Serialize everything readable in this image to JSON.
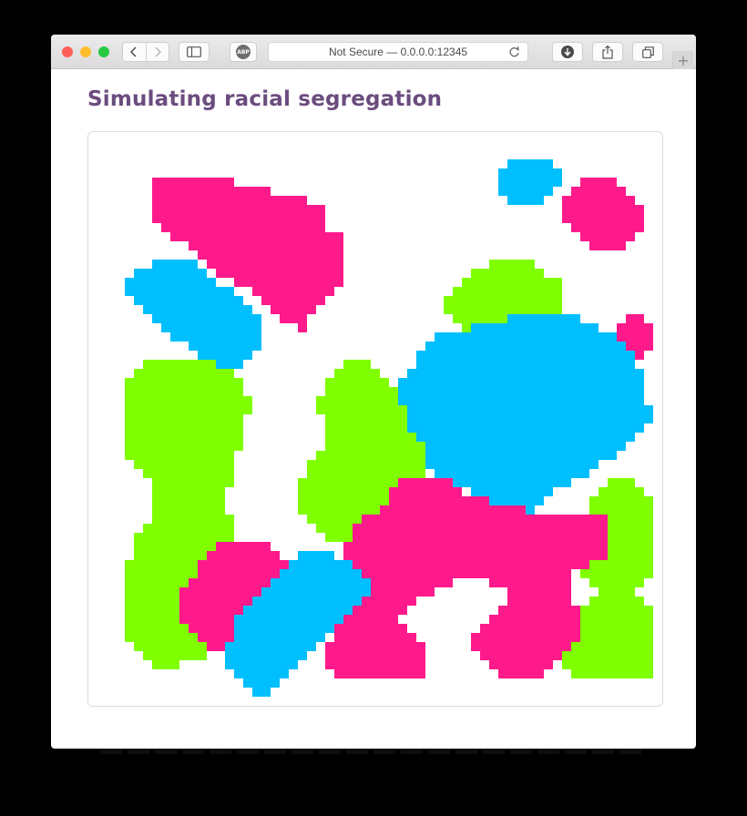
{
  "browser": {
    "address_text": "Not Secure — 0.0.0.0:12345",
    "adblock_label": "ABP",
    "icons": {
      "close": "close-light",
      "minimize": "minimize-light",
      "maximize": "maximize-light",
      "back": "chevron-left-icon",
      "forward": "chevron-right-icon",
      "sidebar": "sidebar-icon",
      "reload": "reload-icon",
      "download": "download-icon",
      "share": "share-icon",
      "tabs": "tabs-overview-icon",
      "new_tab": "plus-icon"
    },
    "colors": {
      "close": "#ff5f57",
      "minimize": "#ffbd2e",
      "maximize": "#28c940"
    }
  },
  "page": {
    "title": "Simulating racial segregation"
  },
  "simulation": {
    "grid_size": 60,
    "colors": {
      "pink": "#ff1a8c",
      "blue": "#00bfff",
      "green": "#80ff00",
      "empty": "#ffffff"
    },
    "regions": [
      {
        "color": "pink",
        "rows": [
          [
            3,
            5,
            14
          ],
          [
            4,
            5,
            18
          ],
          [
            5,
            5,
            22
          ],
          [
            6,
            5,
            24
          ],
          [
            7,
            5,
            24
          ],
          [
            8,
            6,
            24
          ],
          [
            9,
            7,
            26
          ],
          [
            10,
            9,
            26
          ],
          [
            11,
            10,
            26
          ],
          [
            12,
            11,
            26
          ],
          [
            13,
            12,
            26
          ],
          [
            14,
            14,
            26
          ],
          [
            15,
            16,
            25
          ],
          [
            16,
            17,
            24
          ],
          [
            17,
            18,
            23
          ],
          [
            18,
            19,
            22
          ],
          [
            19,
            21,
            22
          ]
        ]
      },
      {
        "color": "blue",
        "rows": [
          [
            12,
            5,
            10
          ],
          [
            13,
            3,
            11
          ],
          [
            14,
            2,
            12
          ],
          [
            15,
            2,
            14
          ],
          [
            16,
            3,
            15
          ],
          [
            17,
            4,
            16
          ],
          [
            18,
            5,
            17
          ],
          [
            19,
            6,
            17
          ],
          [
            20,
            7,
            17
          ],
          [
            21,
            9,
            17
          ],
          [
            22,
            10,
            16
          ],
          [
            23,
            12,
            15
          ]
        ]
      },
      {
        "color": "blue",
        "rows": [
          [
            1,
            44,
            49
          ],
          [
            2,
            43,
            50
          ],
          [
            3,
            43,
            50
          ],
          [
            4,
            43,
            49
          ],
          [
            5,
            44,
            48
          ]
        ]
      },
      {
        "color": "pink",
        "rows": [
          [
            3,
            52,
            56
          ],
          [
            4,
            51,
            57
          ],
          [
            5,
            50,
            58
          ],
          [
            6,
            50,
            59
          ],
          [
            7,
            50,
            59
          ],
          [
            8,
            51,
            59
          ],
          [
            9,
            52,
            58
          ],
          [
            10,
            53,
            57
          ]
        ]
      },
      {
        "color": "pink",
        "rows": [
          [
            18,
            57,
            59
          ],
          [
            19,
            56,
            60
          ],
          [
            20,
            55,
            60
          ],
          [
            21,
            55,
            60
          ],
          [
            22,
            56,
            59
          ],
          [
            23,
            57,
            58
          ]
        ]
      },
      {
        "color": "green",
        "rows": [
          [
            12,
            42,
            47
          ],
          [
            13,
            40,
            48
          ],
          [
            14,
            39,
            50
          ],
          [
            15,
            38,
            50
          ],
          [
            16,
            37,
            50
          ],
          [
            17,
            37,
            50
          ],
          [
            18,
            38,
            50
          ],
          [
            19,
            39,
            44
          ]
        ]
      },
      {
        "color": "blue",
        "rows": [
          [
            18,
            44,
            52
          ],
          [
            19,
            40,
            54
          ],
          [
            20,
            36,
            56
          ],
          [
            21,
            35,
            57
          ],
          [
            22,
            34,
            58
          ],
          [
            23,
            34,
            58
          ],
          [
            24,
            33,
            59
          ],
          [
            25,
            32,
            59
          ],
          [
            26,
            32,
            59
          ],
          [
            27,
            31,
            59
          ],
          [
            28,
            31,
            60
          ],
          [
            29,
            31,
            60
          ],
          [
            30,
            31,
            59
          ],
          [
            31,
            32,
            58
          ],
          [
            32,
            32,
            57
          ],
          [
            33,
            33,
            56
          ],
          [
            34,
            34,
            54
          ],
          [
            35,
            36,
            53
          ],
          [
            36,
            38,
            51
          ],
          [
            37,
            40,
            49
          ],
          [
            38,
            42,
            48
          ],
          [
            39,
            43,
            47
          ]
        ]
      },
      {
        "color": "green",
        "rows": [
          [
            23,
            4,
            12
          ],
          [
            24,
            3,
            14
          ],
          [
            25,
            2,
            15
          ],
          [
            26,
            2,
            15
          ],
          [
            27,
            2,
            16
          ],
          [
            28,
            2,
            16
          ],
          [
            29,
            2,
            15
          ],
          [
            30,
            2,
            15
          ],
          [
            31,
            2,
            15
          ],
          [
            32,
            2,
            15
          ],
          [
            33,
            2,
            14
          ],
          [
            34,
            3,
            14
          ],
          [
            35,
            4,
            14
          ],
          [
            36,
            5,
            14
          ],
          [
            37,
            5,
            13
          ],
          [
            38,
            5,
            13
          ],
          [
            39,
            5,
            13
          ],
          [
            40,
            5,
            14
          ],
          [
            41,
            4,
            14
          ],
          [
            42,
            3,
            14
          ],
          [
            43,
            3,
            14
          ],
          [
            44,
            3,
            13
          ],
          [
            45,
            2,
            13
          ],
          [
            46,
            2,
            13
          ],
          [
            47,
            2,
            14
          ],
          [
            48,
            2,
            14
          ],
          [
            49,
            2,
            14
          ],
          [
            50,
            2,
            14
          ],
          [
            51,
            2,
            13
          ],
          [
            52,
            2,
            13
          ],
          [
            53,
            2,
            12
          ],
          [
            54,
            3,
            11
          ],
          [
            55,
            4,
            11
          ],
          [
            56,
            5,
            8
          ]
        ]
      },
      {
        "color": "green",
        "rows": [
          [
            23,
            26,
            29
          ],
          [
            24,
            25,
            30
          ],
          [
            25,
            24,
            31
          ],
          [
            26,
            24,
            32
          ],
          [
            27,
            23,
            32
          ],
          [
            28,
            23,
            33
          ],
          [
            29,
            24,
            33
          ],
          [
            30,
            24,
            33
          ],
          [
            31,
            24,
            34
          ],
          [
            32,
            24,
            35
          ],
          [
            33,
            23,
            35
          ],
          [
            34,
            22,
            35
          ],
          [
            35,
            22,
            35
          ],
          [
            36,
            21,
            35
          ],
          [
            37,
            21,
            34
          ],
          [
            38,
            21,
            33
          ],
          [
            39,
            21,
            32
          ],
          [
            40,
            22,
            31
          ],
          [
            41,
            23,
            30
          ],
          [
            42,
            24,
            29
          ]
        ]
      },
      {
        "color": "green",
        "rows": [
          [
            36,
            55,
            58
          ],
          [
            37,
            54,
            59
          ],
          [
            38,
            53,
            60
          ],
          [
            39,
            53,
            60
          ],
          [
            40,
            52,
            60
          ],
          [
            41,
            51,
            60
          ],
          [
            42,
            51,
            60
          ],
          [
            43,
            51,
            60
          ],
          [
            44,
            52,
            60
          ],
          [
            45,
            52,
            60
          ],
          [
            46,
            52,
            60
          ],
          [
            47,
            53,
            59
          ],
          [
            48,
            54,
            58
          ],
          [
            49,
            53,
            59
          ],
          [
            50,
            52,
            60
          ],
          [
            51,
            51,
            60
          ],
          [
            52,
            50,
            60
          ],
          [
            53,
            50,
            60
          ],
          [
            54,
            49,
            60
          ],
          [
            55,
            49,
            60
          ],
          [
            56,
            50,
            60
          ],
          [
            57,
            51,
            60
          ]
        ]
      },
      {
        "color": "pink",
        "rows": [
          [
            36,
            32,
            38
          ],
          [
            37,
            31,
            39
          ],
          [
            38,
            31,
            42
          ],
          [
            39,
            30,
            46
          ],
          [
            40,
            28,
            55
          ],
          [
            41,
            27,
            55
          ],
          [
            42,
            27,
            55
          ],
          [
            43,
            26,
            55
          ],
          [
            44,
            26,
            55
          ],
          [
            45,
            26,
            53
          ],
          [
            46,
            26,
            51
          ],
          [
            47,
            26,
            38
          ],
          [
            47,
            42,
            51
          ],
          [
            48,
            27,
            36
          ],
          [
            48,
            44,
            51
          ],
          [
            49,
            27,
            34
          ],
          [
            49,
            44,
            51
          ],
          [
            50,
            27,
            33
          ],
          [
            50,
            43,
            52
          ],
          [
            51,
            26,
            32
          ],
          [
            51,
            42,
            52
          ],
          [
            52,
            25,
            33
          ],
          [
            52,
            41,
            52
          ],
          [
            53,
            25,
            34
          ],
          [
            53,
            40,
            52
          ],
          [
            54,
            24,
            35
          ],
          [
            54,
            40,
            51
          ],
          [
            55,
            24,
            35
          ],
          [
            55,
            41,
            50
          ],
          [
            56,
            24,
            35
          ],
          [
            56,
            42,
            49
          ],
          [
            57,
            25,
            35
          ],
          [
            57,
            43,
            48
          ]
        ]
      },
      {
        "color": "pink",
        "rows": [
          [
            43,
            12,
            18
          ],
          [
            44,
            11,
            19
          ],
          [
            45,
            10,
            20
          ],
          [
            46,
            10,
            20
          ],
          [
            47,
            9,
            20
          ],
          [
            48,
            8,
            19
          ],
          [
            49,
            8,
            18
          ],
          [
            50,
            8,
            17
          ],
          [
            51,
            8,
            16
          ],
          [
            52,
            9,
            15
          ],
          [
            53,
            10,
            14
          ],
          [
            54,
            11,
            13
          ]
        ]
      },
      {
        "color": "blue",
        "rows": [
          [
            44,
            21,
            25
          ],
          [
            45,
            20,
            27
          ],
          [
            46,
            19,
            28
          ],
          [
            47,
            18,
            29
          ],
          [
            48,
            17,
            29
          ],
          [
            49,
            16,
            28
          ],
          [
            50,
            15,
            27
          ],
          [
            51,
            14,
            26
          ],
          [
            52,
            14,
            25
          ],
          [
            53,
            14,
            24
          ],
          [
            54,
            13,
            23
          ],
          [
            55,
            13,
            22
          ],
          [
            56,
            13,
            21
          ],
          [
            57,
            14,
            20
          ],
          [
            58,
            15,
            19
          ],
          [
            59,
            16,
            18
          ]
        ]
      }
    ]
  }
}
